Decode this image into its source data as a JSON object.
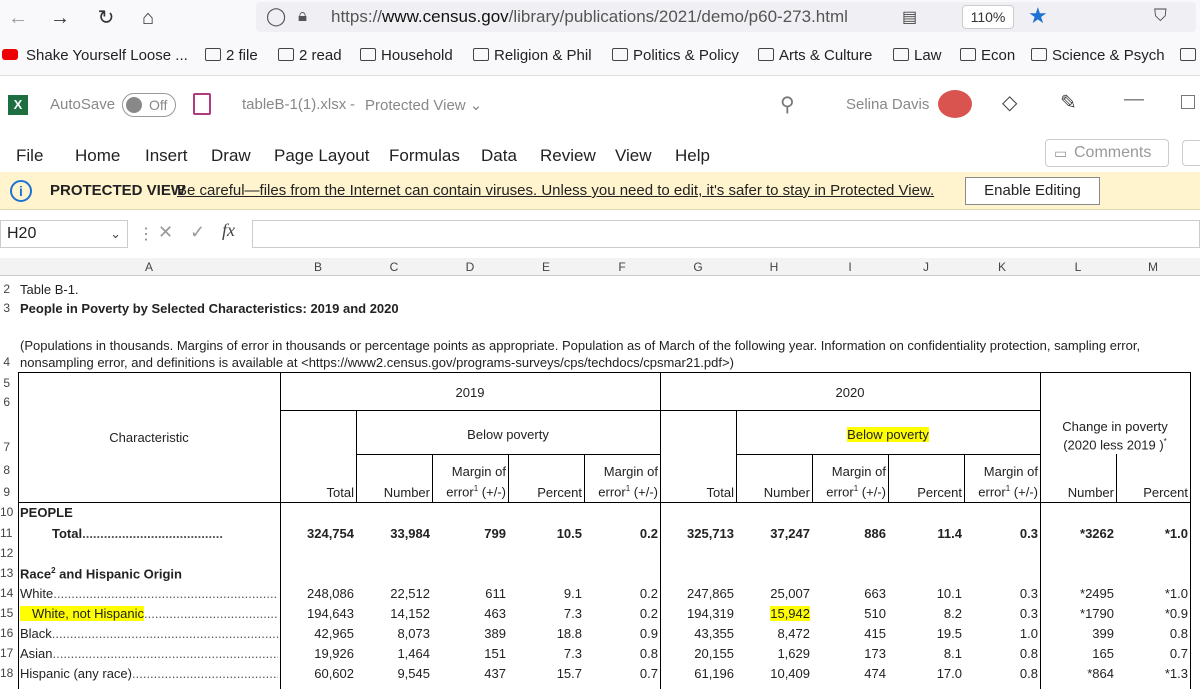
{
  "browser": {
    "url_prefix": "https://",
    "url_domain": "www.census.gov",
    "url_path": "/library/publications/2021/demo/p60-273.html",
    "zoom": "110%"
  },
  "bookmarks": [
    "Shake Yourself Loose ...",
    "2 file",
    "2 read",
    "Household",
    "Religion & Phil",
    "Politics & Policy",
    "Arts & Culture",
    "Law",
    "Econ",
    "Science & Psych"
  ],
  "excel": {
    "autosave": "AutoSave",
    "toggle": "Off",
    "filename": "tableB-1(1).xlsx",
    "sep": "-",
    "mode": "Protected View",
    "user": "Selina Davis",
    "tabs": [
      "File",
      "Home",
      "Insert",
      "Draw",
      "Page Layout",
      "Formulas",
      "Data",
      "Review",
      "View",
      "Help"
    ],
    "comments": "Comments",
    "protected_title": "PROTECTED VIEW",
    "protected_msg": "Be careful—files from the Internet can contain viruses. Unless you need to edit, it's safer to stay in Protected View.",
    "enable_editing": "Enable Editing",
    "namebox": "H20",
    "fx": "fx"
  },
  "columns": [
    "A",
    "B",
    "C",
    "D",
    "E",
    "F",
    "G",
    "H",
    "I",
    "J",
    "K",
    "L",
    "M"
  ],
  "rows": [
    "2",
    "3",
    "4",
    "5",
    "6",
    "7",
    "8",
    "9",
    "10",
    "11",
    "12",
    "13",
    "14",
    "15",
    "16",
    "17",
    "18"
  ],
  "sheet": {
    "table_id": "Table B-1.",
    "title": "People in Poverty by Selected Characteristics: 2019 and 2020",
    "note1": "(Populations in thousands. Margins of error in thousands or percentage points as appropriate. Population as of March of the following year. Information on confidentiality protection, sampling error,",
    "note2": "nonsampling error, and definitions is available at <https://www2.census.gov/programs-surveys/cps/techdocs/cpsmar21.pdf>)",
    "characteristic": "Characteristic",
    "year1": "2019",
    "year2": "2020",
    "below1": "Below poverty",
    "below2": "Below poverty",
    "change1": "Change in poverty",
    "change2": "(2020 less 2019 )",
    "moe": "Margin of",
    "err": "error",
    "pm": " (+/-)",
    "sup1": "1",
    "sup2": "2",
    "star": "*",
    "h_total": "Total",
    "h_number": "Number",
    "h_percent": "Percent",
    "people": "PEOPLE",
    "race_label": "Race",
    "race_suffix": " and Hispanic Origin",
    "data_rows": [
      {
        "label": "Total",
        "vals": [
          "324,754",
          "33,984",
          "799",
          "10.5",
          "0.2",
          "325,713",
          "37,247",
          "886",
          "11.4",
          "0.3",
          "*3262",
          "*1.0"
        ]
      },
      {
        "label": "White",
        "vals": [
          "248,086",
          "22,512",
          "611",
          "9.1",
          "0.2",
          "247,865",
          "25,007",
          "663",
          "10.1",
          "0.3",
          "*2495",
          "*1.0"
        ]
      },
      {
        "label": "White, not Hispanic",
        "vals": [
          "194,643",
          "14,152",
          "463",
          "7.3",
          "0.2",
          "194,319",
          "15,942",
          "510",
          "8.2",
          "0.3",
          "*1790",
          "*0.9"
        ]
      },
      {
        "label": "Black",
        "vals": [
          "42,965",
          "8,073",
          "389",
          "18.8",
          "0.9",
          "43,355",
          "8,472",
          "415",
          "19.5",
          "1.0",
          "399",
          "0.8"
        ]
      },
      {
        "label": "Asian",
        "vals": [
          "19,926",
          "1,464",
          "151",
          "7.3",
          "0.8",
          "20,155",
          "1,629",
          "173",
          "8.1",
          "0.8",
          "165",
          "0.7"
        ]
      },
      {
        "label": "Hispanic (any race)",
        "vals": [
          "60,602",
          "9,545",
          "437",
          "15.7",
          "0.7",
          "61,196",
          "10,409",
          "474",
          "17.0",
          "0.8",
          "*864",
          "*1.3"
        ]
      }
    ]
  }
}
